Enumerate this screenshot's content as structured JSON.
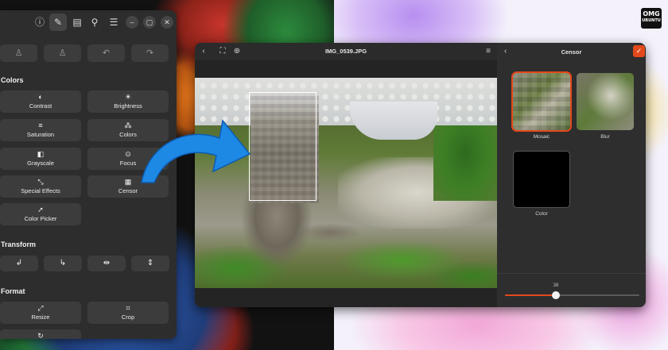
{
  "brand": {
    "omg_line1": "OMG",
    "omg_line2": "UBUNTU"
  },
  "tools_panel": {
    "header_icons": [
      "info-icon",
      "brush-icon",
      "chat-icon",
      "tools-icon",
      "menu-icon"
    ],
    "window_controls": [
      "minimize-icon",
      "maximize-icon",
      "close-icon"
    ],
    "toolbar_icons": [
      "voice-icon",
      "mic-icon",
      "undo-icon",
      "redo-icon"
    ],
    "colors_section": "Colors",
    "color_tools": [
      {
        "label": "Contrast",
        "icon": "◐"
      },
      {
        "label": "Brightness",
        "icon": "☀"
      },
      {
        "label": "Saturation",
        "icon": "≡"
      },
      {
        "label": "Colors",
        "icon": "⁂"
      },
      {
        "label": "Grayscale",
        "icon": "◧"
      },
      {
        "label": "Focus",
        "icon": "⊙"
      },
      {
        "label": "Special Effects",
        "icon": "⤡"
      },
      {
        "label": "Censor",
        "icon": "▦"
      },
      {
        "label": "Color Picker",
        "icon": "➚"
      }
    ],
    "transform_section": "Transform",
    "transform_tools": [
      "↲",
      "↳",
      "⇹",
      "⇕"
    ],
    "format_section": "Format",
    "format_tools": [
      {
        "label": "Resize",
        "icon": "⤢"
      },
      {
        "label": "Crop",
        "icon": "⌗"
      }
    ],
    "partial_tool_icon": "↻"
  },
  "viewer": {
    "title": "IMG_0539.JPG",
    "header_icons": [
      "back-icon",
      "fullscreen-icon",
      "zoom-icon",
      "menu-icon"
    ]
  },
  "censor_panel": {
    "title": "Censor",
    "options": [
      {
        "label": "Mosaic",
        "selected": true
      },
      {
        "label": "Blur",
        "selected": false
      },
      {
        "label": "Color",
        "selected": false
      }
    ],
    "slider_value": "38",
    "slider_fraction": 0.38
  },
  "colors": {
    "accent": "#e4491b",
    "panel_bg": "#2d2d2d",
    "button_bg": "#3c3c3c",
    "arrow": "#1e88e5"
  }
}
